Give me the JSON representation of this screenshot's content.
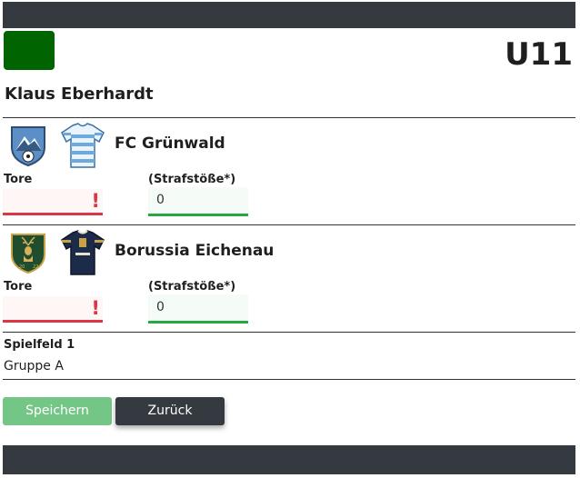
{
  "header": {
    "age_group": "U11",
    "referee_name": "Klaus Eberhardt",
    "brand_color": "#006400"
  },
  "teams": [
    {
      "name": "FC Grünwald",
      "crest_icon": "mountain-shield-crest",
      "shirt_icon": "light-blue-striped-shirt",
      "goals_label": "Tore",
      "goals_value": "",
      "penalties_label": "(Strafstöße*)",
      "penalties_value": "0"
    },
    {
      "name": "Borussia Eichenau",
      "crest_icon": "deer-shield-crest",
      "shirt_icon": "navy-shirt",
      "goals_label": "Tore",
      "goals_value": "",
      "penalties_label": "(Strafstöße*)",
      "penalties_value": "0"
    }
  ],
  "match": {
    "field_label": "Spielfeld 1",
    "group_label": "Gruppe A"
  },
  "actions": {
    "save_label": "Speichern",
    "back_label": "Zurück"
  },
  "colors": {
    "error": "#dc3545",
    "success": "#28a745",
    "dark": "#343a40"
  }
}
